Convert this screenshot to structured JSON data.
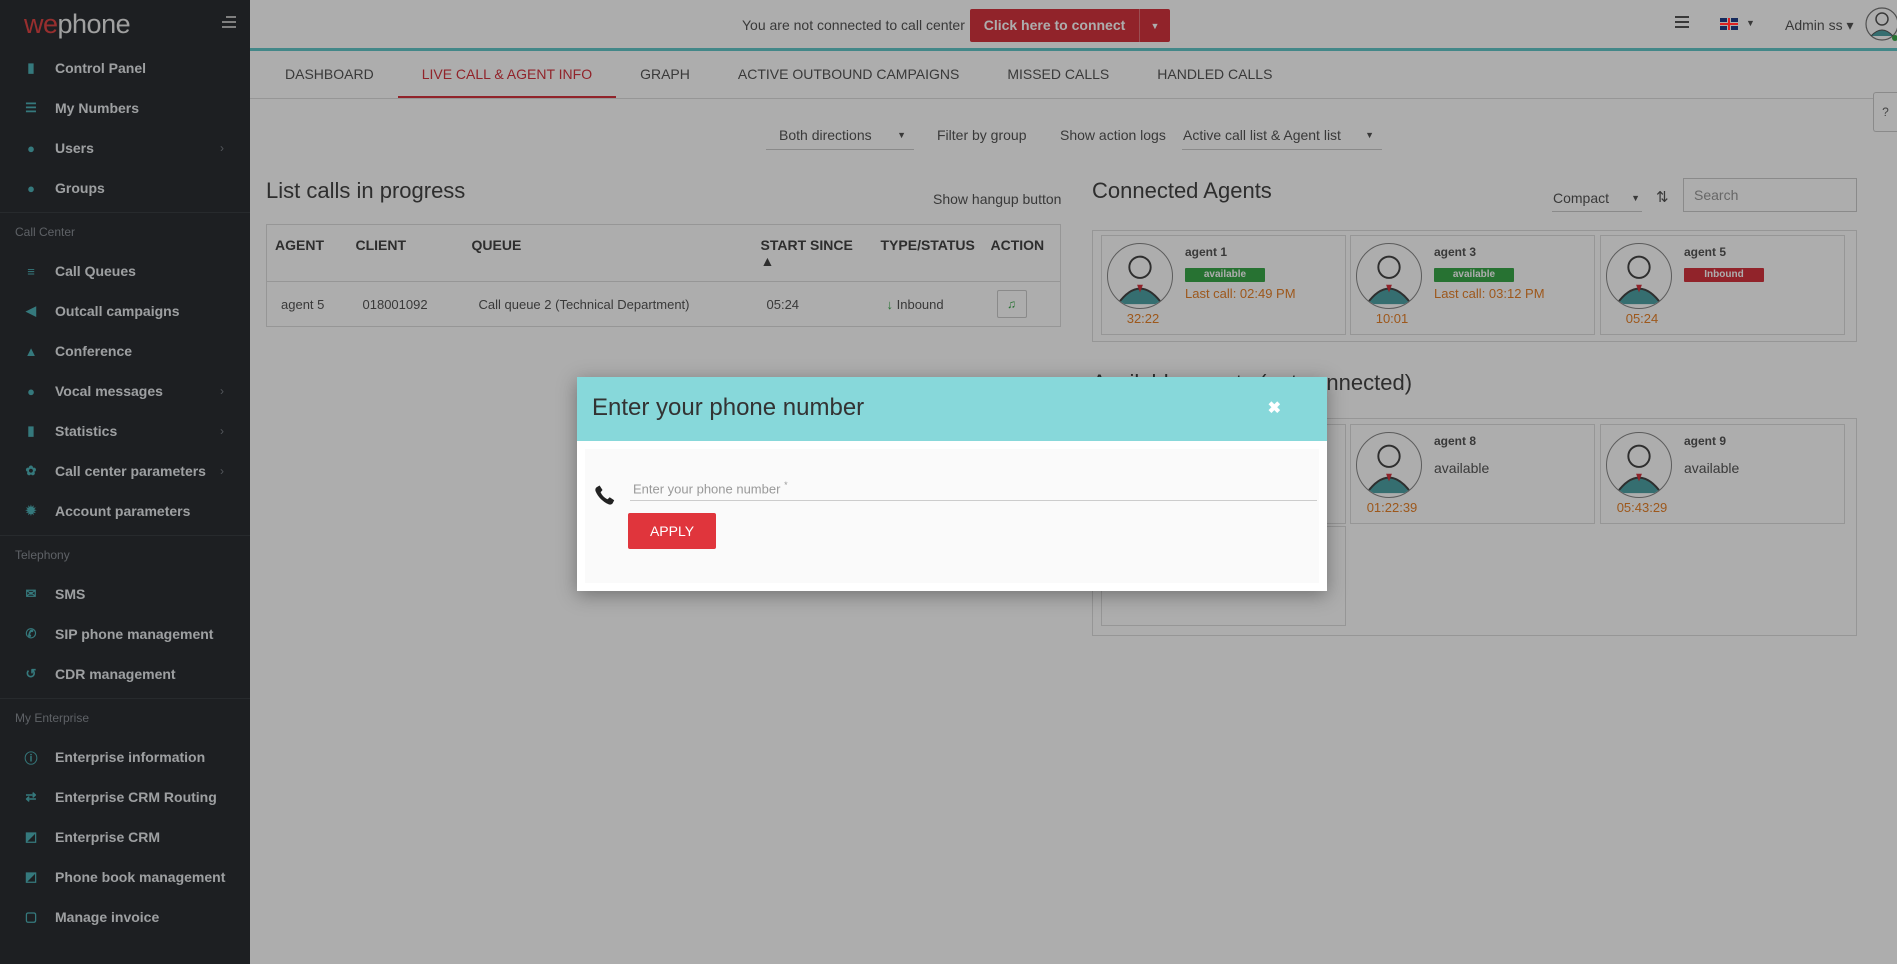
{
  "brand": {
    "part1": "we",
    "part2": "phone"
  },
  "sidebar": {
    "items_top": [
      {
        "label": "Control Panel",
        "icon": "bar-chart-icon"
      },
      {
        "label": "My Numbers",
        "icon": "list-icon"
      },
      {
        "label": "Users",
        "icon": "users-icon",
        "has_sub": true
      },
      {
        "label": "Groups",
        "icon": "group-icon"
      }
    ],
    "section_call_center": "Call Center",
    "items_cc": [
      {
        "label": "Call Queues",
        "icon": "queue-icon"
      },
      {
        "label": "Outcall campaigns",
        "icon": "volume-icon"
      },
      {
        "label": "Conference",
        "icon": "bank-icon"
      },
      {
        "label": "Vocal messages",
        "icon": "mic-icon",
        "has_sub": true
      },
      {
        "label": "Statistics",
        "icon": "stats-icon",
        "has_sub": true
      },
      {
        "label": "Call center parameters",
        "icon": "cogs-icon",
        "has_sub": true
      },
      {
        "label": "Account parameters",
        "icon": "gear-icon"
      }
    ],
    "section_telephony": "Telephony",
    "items_tel": [
      {
        "label": "SMS",
        "icon": "envelope-icon"
      },
      {
        "label": "SIP phone management",
        "icon": "phone-icon"
      },
      {
        "label": "CDR management",
        "icon": "history-icon"
      }
    ],
    "section_enterprise": "My Enterprise",
    "items_ent": [
      {
        "label": "Enterprise information",
        "icon": "info-icon"
      },
      {
        "label": "Enterprise CRM Routing",
        "icon": "exchange-icon"
      },
      {
        "label": "Enterprise CRM",
        "icon": "share-icon"
      },
      {
        "label": "Phone book management",
        "icon": "share-icon"
      },
      {
        "label": "Manage invoice",
        "icon": "file-icon"
      }
    ]
  },
  "topbar": {
    "not_connected_text": "You are not connected to call center",
    "connect_label": "Click here to connect",
    "user_label": "Admin ss"
  },
  "tabs": [
    "DASHBOARD",
    "LIVE CALL & AGENT INFO",
    "GRAPH",
    "ACTIVE OUTBOUND CAMPAIGNS",
    "MISSED CALLS",
    "HANDLED CALLS"
  ],
  "filters": {
    "directions": "Both directions",
    "filter_group": "Filter by group",
    "action_logs": "Show action logs",
    "view_mode": "Active call list & Agent list"
  },
  "calls": {
    "title": "List calls in progress",
    "hangup_label": "Show hangup button",
    "columns": [
      "AGENT",
      "CLIENT",
      "QUEUE",
      "START SINCE ▲",
      "TYPE/STATUS",
      "ACTION"
    ],
    "rows": [
      {
        "agent": "agent 5",
        "client": "018001092",
        "queue": "Call queue 2 (Technical Department)",
        "since": "05:24",
        "type": "Inbound"
      }
    ]
  },
  "agents": {
    "title": "Connected Agents",
    "compact_label": "Compact",
    "search_placeholder": "Search",
    "connected": [
      {
        "name": "agent 1",
        "badge": "available",
        "last_call": "Last call: 02:49 PM",
        "time": "32:22"
      },
      {
        "name": "agent 3",
        "badge": "available",
        "last_call": "Last call: 03:12 PM",
        "time": "10:01"
      },
      {
        "name": "agent 5",
        "badge": "Inbound",
        "last_call": "",
        "time": "05:24"
      }
    ],
    "available_title": "Available agents (not connected)",
    "available": [
      {
        "name": "agent 8",
        "status": "available",
        "time": "01:22:39"
      },
      {
        "name": "agent 9",
        "status": "available",
        "time": "05:43:29"
      }
    ]
  },
  "modal": {
    "title": "Enter your phone number",
    "placeholder": "Enter your phone number",
    "required_mark": "*",
    "apply_label": "APPLY"
  },
  "colors": {
    "accent": "#d6343e",
    "teal": "#87d8da",
    "available": "#3aa84a",
    "orange": "#e8822a"
  }
}
